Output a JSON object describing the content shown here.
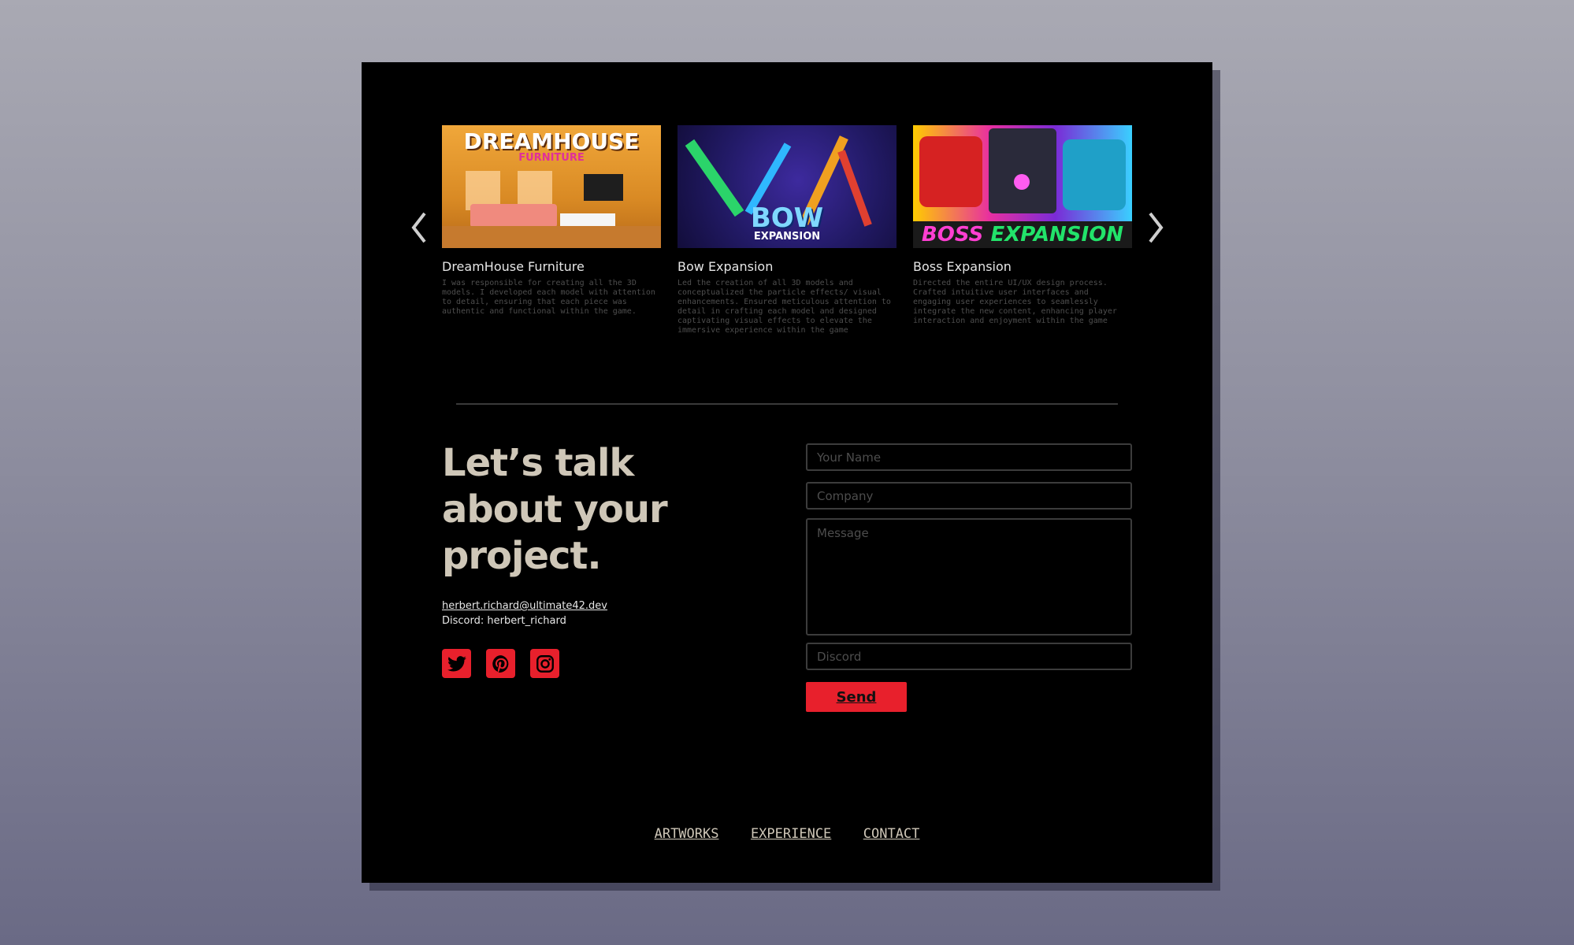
{
  "carousel": {
    "prev_icon": "chevron-left-icon",
    "next_icon": "chevron-right-icon",
    "cards": [
      {
        "title": "DreamHouse Furniture",
        "image_text_main": "DREAMHOUSE",
        "image_text_sub": "FURNITURE",
        "description": "I was responsible for creating all the 3D models. I developed each model with attention to detail, ensuring that each piece was authentic and functional within the game."
      },
      {
        "title": "Bow Expansion",
        "image_text_main": "BOW",
        "image_text_sub": "EXPANSION",
        "description": "Led the creation of all 3D models and conceptualized the particle effects/ visual enhancements. Ensured meticulous attention to detail in crafting each model and designed captivating visual effects to elevate the immersive experience within the game"
      },
      {
        "title": "Boss Expansion",
        "image_text_main": "BOSS",
        "image_text_sub": "EXPANSION",
        "description": "Directed the entire UI/UX design process. Crafted intuitive user interfaces and engaging user experiences to seamlessly integrate the new content, enhancing player interaction and enjoyment within the game"
      }
    ]
  },
  "contact": {
    "headline": "Let’s talk about your project.",
    "email": "herbert.richard@ultimate42.dev",
    "discord": "Discord: herbert_richard",
    "socials": [
      "twitter-icon",
      "pinterest-icon",
      "instagram-icon"
    ],
    "accent_color": "#e8202c"
  },
  "form": {
    "name_placeholder": "Your Name",
    "company_placeholder": "Company",
    "message_placeholder": "Message",
    "discord_placeholder": "Discord",
    "send_label": "Send"
  },
  "footer": {
    "links": [
      "ARTWORKS",
      "EXPERIENCE",
      "CONTACT"
    ]
  }
}
